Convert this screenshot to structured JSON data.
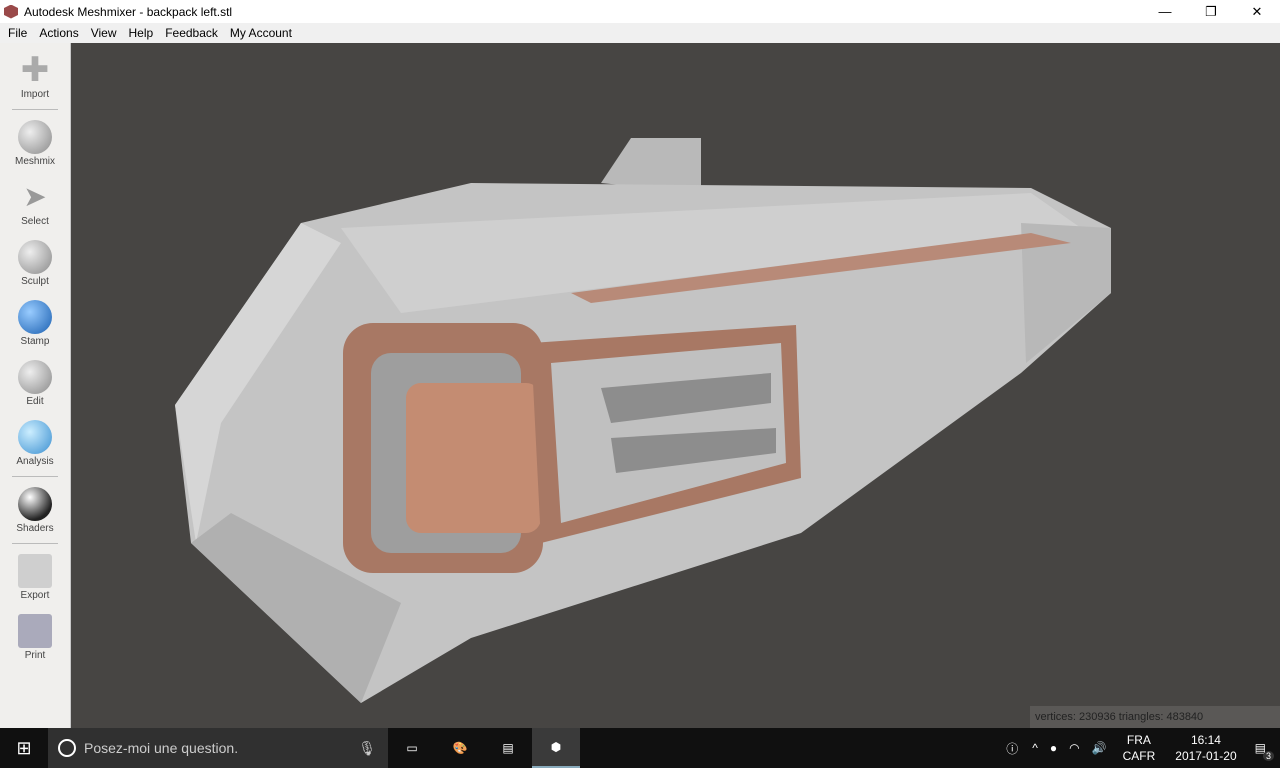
{
  "window": {
    "title": "Autodesk Meshmixer - backpack left.stl",
    "minimize": "—",
    "restore": "❐",
    "close": "✕"
  },
  "menu": [
    "File",
    "Actions",
    "View",
    "Help",
    "Feedback",
    "My Account"
  ],
  "tools": [
    "Import",
    "Meshmix",
    "Select",
    "Sculpt",
    "Stamp",
    "Edit",
    "Analysis",
    "Shaders",
    "Export",
    "Print"
  ],
  "stats": "vertices: 230936 triangles: 483840",
  "taskbar": {
    "search_placeholder": "Posez-moi une question.",
    "lang1": "FRA",
    "lang2": "CAFR",
    "time": "16:14",
    "date": "2017-01-20",
    "notifications": "3"
  }
}
